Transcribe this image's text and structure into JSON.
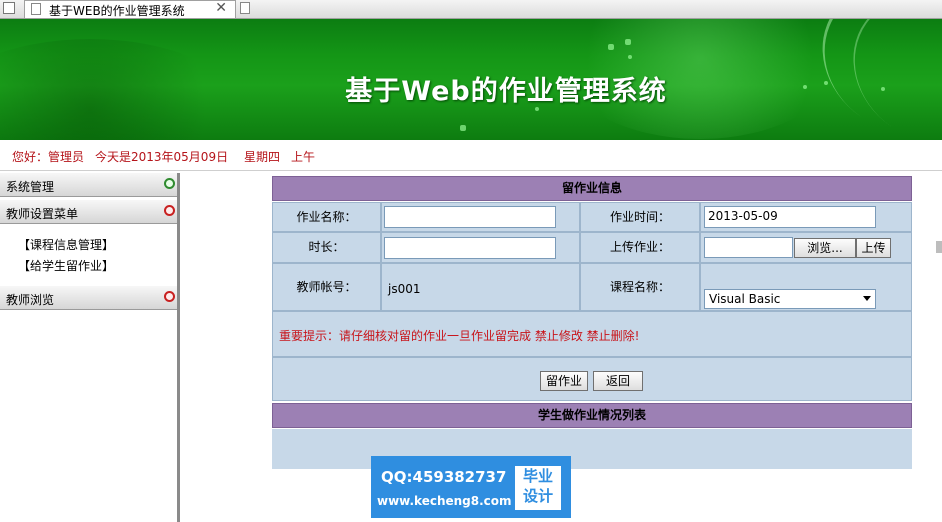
{
  "browser": {
    "tab_title": "基于WEB的作业管理系统",
    "close_glyph": "✕"
  },
  "banner": {
    "title": "基于Web的作业管理系统"
  },
  "welcome": {
    "greeting": "您好：管理员",
    "date_text": "今天是2013年05月09日",
    "weekday": "星期四",
    "period": "上午"
  },
  "sidebar": {
    "menus": [
      {
        "label": "系统管理",
        "state_icon": "expand-icon",
        "color": "#2f8b2f"
      },
      {
        "label": "教师设置菜单",
        "state_icon": "collapse-icon",
        "color": "#c82020"
      },
      {
        "label": "教师浏览",
        "state_icon": "collapse-icon",
        "color": "#c82020"
      }
    ],
    "links": [
      {
        "label": "【课程信息管理】"
      },
      {
        "label": "【给学生留作业】"
      }
    ]
  },
  "form": {
    "section_title": "留作业信息",
    "name_label": "作业名称：",
    "name_value": "",
    "time_label": "作业时间：",
    "time_value": "2013-05-09",
    "duration_label": "时长：",
    "duration_value": "",
    "upload_label": "上传作业：",
    "browse_label": "浏览...",
    "upload_button": "上传",
    "teacher_label": "教师帐号：",
    "teacher_value": "js001",
    "course_label": "课程名称：",
    "course_selected": "Visual Basic",
    "notice": "重要提示：请仔细核对留的作业一旦作业留完成 禁止修改 禁止删除!",
    "submit_label": "留作业",
    "back_label": "返回",
    "list_title": "学生做作业情况列表"
  },
  "watermark": {
    "qq": "QQ:459382737",
    "url": "www.kecheng8.com",
    "badge_line1": "毕业",
    "badge_line2": "设计"
  },
  "colors": {
    "banner_green": "#149616",
    "accent_red": "#b5141a",
    "section_purple": "#9c80b4",
    "cell_blue": "#c7d8e8"
  }
}
